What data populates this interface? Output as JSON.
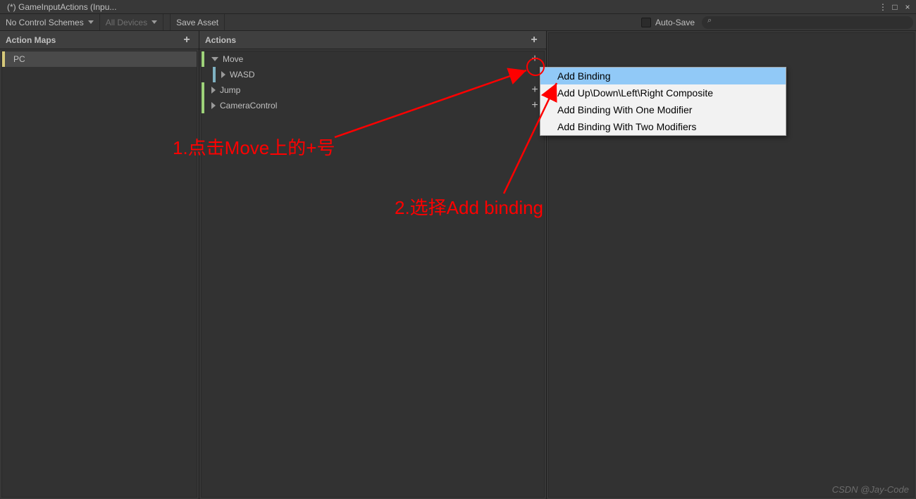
{
  "title": "(*) GameInputActions (Inpu...",
  "window": {
    "minimize": "–",
    "maximize": "□",
    "close": "×",
    "kebab": "⋮"
  },
  "toolbar": {
    "control_schemes": "No Control Schemes",
    "devices": "All Devices",
    "save_asset": "Save Asset",
    "auto_save_label": "Auto-Save",
    "search_placeholder": ""
  },
  "columns": {
    "maps_header": "Action Maps",
    "actions_header": "Actions"
  },
  "maps": [
    {
      "name": "PC",
      "selected": true
    }
  ],
  "actions": [
    {
      "name": "Move",
      "expanded": true,
      "color": "green",
      "children": [
        {
          "name": "WASD",
          "color": "blue"
        }
      ]
    },
    {
      "name": "Jump",
      "expanded": false,
      "color": "green"
    },
    {
      "name": "CameraControl",
      "expanded": false,
      "color": "green"
    }
  ],
  "context_menu": {
    "items": [
      "Add Binding",
      "Add Up\\Down\\Left\\Right Composite",
      "Add Binding With One Modifier",
      "Add Binding With Two Modifiers"
    ],
    "highlighted_index": 0
  },
  "annotations": {
    "step1": "1.点击Move上的+号",
    "step2": "2.选择Add binding"
  },
  "watermark": "CSDN @Jay-Code"
}
